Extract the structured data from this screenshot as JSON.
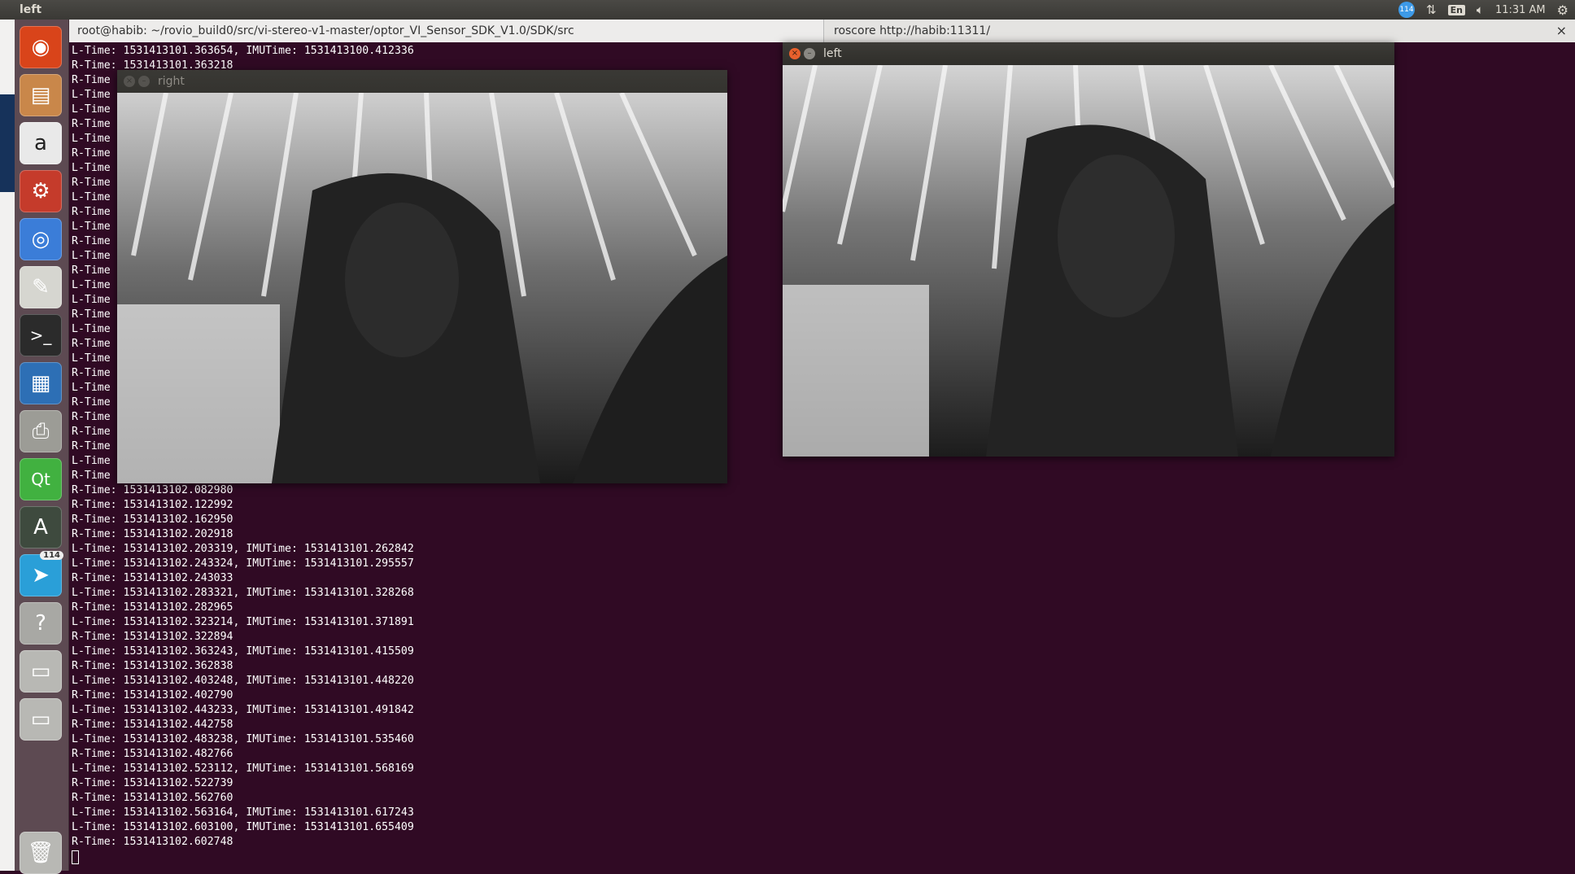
{
  "topbar": {
    "window_title": "left",
    "mail_count": "114",
    "keyboard_layout": "En",
    "time": "11:31 AM",
    "icons": [
      "network-icon",
      "keyboard-layout-icon",
      "volume-icon",
      "settings-gear-icon"
    ]
  },
  "launcher": {
    "items": [
      {
        "name": "ubuntu-dash-icon",
        "glyph": "◉",
        "color": "#d9441a"
      },
      {
        "name": "files-icon",
        "glyph": "▤",
        "color": "#c9874a"
      },
      {
        "name": "amazon-icon",
        "glyph": "a",
        "color": "#e9e9e9"
      },
      {
        "name": "system-settings-icon",
        "glyph": "⚙",
        "color": "#c53b2b"
      },
      {
        "name": "chromium-icon",
        "glyph": "◎",
        "color": "#3b7dd8"
      },
      {
        "name": "text-editor-icon",
        "glyph": "✎",
        "color": "#d6d6d0"
      },
      {
        "name": "terminal-icon",
        "glyph": ">_",
        "color": "#2b2b2b"
      },
      {
        "name": "libreoffice-writer-icon",
        "glyph": "▦",
        "color": "#2d6fb5"
      },
      {
        "name": "printer-icon",
        "glyph": "⎙",
        "color": "#9c9c96"
      },
      {
        "name": "qt-creator-icon",
        "glyph": "Qt",
        "color": "#41b140"
      },
      {
        "name": "software-updater-icon",
        "glyph": "A",
        "color": "#3e4a3e"
      },
      {
        "name": "telegram-icon",
        "glyph": "➤",
        "color": "#2a9fd8",
        "badge": "114"
      },
      {
        "name": "help-icon",
        "glyph": "?",
        "color": "#a8a8a4"
      },
      {
        "name": "drive-icon",
        "glyph": "▭",
        "color": "#b8b8b4"
      },
      {
        "name": "drive-2-icon",
        "glyph": "▭",
        "color": "#b8b8b4"
      },
      {
        "name": "trash-icon",
        "glyph": "🗑",
        "color": "#b8b8b4"
      }
    ]
  },
  "tabs": [
    {
      "label": "root@habib: ~/rovio_build0/src/vi-stereo-v1-master/optor_VI_Sensor_SDK_V1.0/SDK/src"
    },
    {
      "label": "roscore http://habib:11311/"
    }
  ],
  "terminal": {
    "top_lines": [
      "L-Time: 1531413101.363654, IMUTime: 1531413100.412336",
      "R-Time: 1531413101.363218"
    ],
    "hidden_prefixes": [
      "R-Time",
      "L-Time",
      "L-Time",
      "R-Time",
      "L-Time",
      "R-Time",
      "L-Time",
      "R-Time",
      "L-Time",
      "R-Time",
      "L-Time",
      "R-Time",
      "L-Time",
      "R-Time",
      "L-Time",
      "L-Time",
      "R-Time",
      "L-Time",
      "R-Time",
      "L-Time",
      "R-Time",
      "L-Time",
      "R-Time",
      "R-Time",
      "R-Time",
      "R-Time",
      "L-Time",
      "R-Time"
    ],
    "bottom_lines": [
      "R-Time: 1531413102.082980",
      "R-Time: 1531413102.122992",
      "R-Time: 1531413102.162950",
      "R-Time: 1531413102.202918",
      "L-Time: 1531413102.203319, IMUTime: 1531413101.262842",
      "L-Time: 1531413102.243324, IMUTime: 1531413101.295557",
      "R-Time: 1531413102.243033",
      "L-Time: 1531413102.283321, IMUTime: 1531413101.328268",
      "R-Time: 1531413102.282965",
      "L-Time: 1531413102.323214, IMUTime: 1531413101.371891",
      "R-Time: 1531413102.322894",
      "L-Time: 1531413102.363243, IMUTime: 1531413101.415509",
      "R-Time: 1531413102.362838",
      "L-Time: 1531413102.403248, IMUTime: 1531413101.448220",
      "R-Time: 1531413102.402790",
      "L-Time: 1531413102.443233, IMUTime: 1531413101.491842",
      "R-Time: 1531413102.442758",
      "L-Time: 1531413102.483238, IMUTime: 1531413101.535460",
      "R-Time: 1531413102.482766",
      "L-Time: 1531413102.523112, IMUTime: 1531413101.568169",
      "R-Time: 1531413102.522739",
      "R-Time: 1531413102.562760",
      "L-Time: 1531413102.563164, IMUTime: 1531413101.617243",
      "L-Time: 1531413102.603100, IMUTime: 1531413101.655409",
      "R-Time: 1531413102.602748"
    ]
  },
  "windows": {
    "right": {
      "title": "right",
      "close_glyph": "×",
      "min_glyph": "–"
    },
    "left": {
      "title": "left",
      "close_glyph": "×",
      "min_glyph": "–"
    }
  }
}
